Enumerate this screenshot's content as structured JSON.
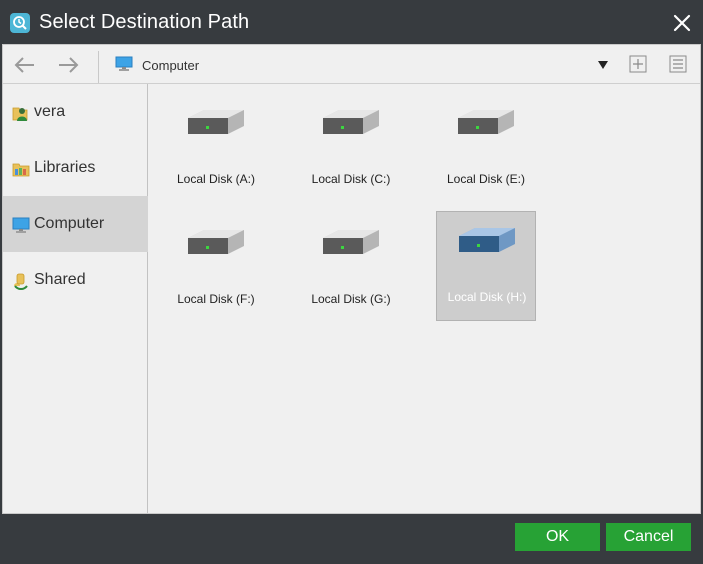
{
  "window": {
    "title": "Select Destination Path"
  },
  "toolbar": {
    "path_label": "Computer"
  },
  "sidebar": {
    "items": [
      {
        "label": "vera",
        "icon": "user-folder-icon"
      },
      {
        "label": "Libraries",
        "icon": "libraries-icon"
      },
      {
        "label": "Computer",
        "icon": "computer-icon",
        "active": true
      },
      {
        "label": "Shared",
        "icon": "shared-icon"
      }
    ]
  },
  "disks": [
    {
      "label": "Local Disk (A:)"
    },
    {
      "label": "Local Disk (C:)"
    },
    {
      "label": "Local Disk (E:)"
    },
    {
      "label": "Local Disk (F:)"
    },
    {
      "label": "Local Disk (G:)"
    },
    {
      "label": "Local Disk (H:)",
      "selected": true
    }
  ],
  "footer": {
    "ok_label": "OK",
    "cancel_label": "Cancel"
  },
  "colors": {
    "titlebar": "#373b3f",
    "accent_green": "#27a235",
    "selected_disk": "#8fb4d9"
  }
}
